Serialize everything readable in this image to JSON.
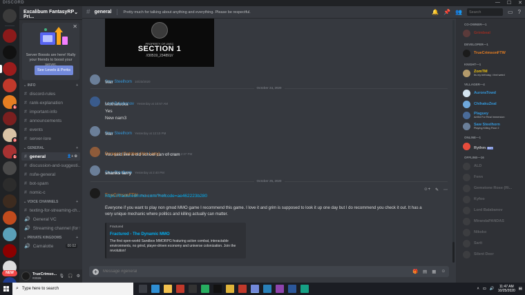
{
  "app": {
    "title": "DISCORD",
    "window_buttons": [
      "—",
      "☐",
      "✕"
    ]
  },
  "guilds": {
    "items": [
      {
        "name": "guild-1",
        "color": "#3b3b3b",
        "badge": ""
      },
      {
        "name": "guild-2",
        "color": "#8b1a1a",
        "badge": ""
      },
      {
        "name": "guild-3",
        "color": "#111111",
        "badge": ""
      },
      {
        "name": "guild-4",
        "color": "#9b1c1c",
        "badge": ""
      },
      {
        "name": "guild-5",
        "color": "#c0392b",
        "badge": ""
      },
      {
        "name": "guild-6",
        "color": "#e67e22",
        "badge": "1"
      },
      {
        "name": "guild-7",
        "color": "#7a1f1f",
        "badge": ""
      },
      {
        "name": "guild-8",
        "color": "#d9c3a5",
        "badge": "3"
      },
      {
        "name": "guild-9",
        "color": "#a83232",
        "badge": "1"
      },
      {
        "name": "guild-10",
        "color": "#4a4a4a",
        "badge": ""
      },
      {
        "name": "guild-11",
        "color": "#2c2c2c",
        "badge": ""
      },
      {
        "name": "guild-12",
        "color": "#3d2b1f",
        "badge": ""
      },
      {
        "name": "guild-13",
        "color": "#c14b1d",
        "badge": ""
      },
      {
        "name": "guild-14",
        "color": "#5aa0b8",
        "badge": ""
      },
      {
        "name": "guild-15",
        "color": "#8b0000",
        "badge": ""
      },
      {
        "name": "guild-16",
        "color": "#dddddd",
        "badge": ""
      },
      {
        "name": "guild-17",
        "color": "#1e3a8a",
        "badge": "1"
      }
    ],
    "new_label": "NEW"
  },
  "server": {
    "name": "Excalibum FantasyRP Pri...",
    "boost": {
      "text": "Server Boosts are here! Rally your friends to boost your server.",
      "button": "See Levels & Perks"
    },
    "categories": [
      {
        "name": "INFO",
        "channels": [
          {
            "label": "discord-rules",
            "type": "text"
          },
          {
            "label": "rank-explanation",
            "type": "text"
          },
          {
            "label": "important-info",
            "type": "text"
          },
          {
            "label": "announcements",
            "type": "text"
          },
          {
            "label": "events",
            "type": "text"
          },
          {
            "label": "server-lore",
            "type": "text"
          }
        ]
      },
      {
        "name": "GENERAL",
        "channels": [
          {
            "label": "general",
            "type": "text",
            "active": true
          },
          {
            "label": "discussion-and-suggesti...",
            "type": "text"
          },
          {
            "label": "nsfw-general",
            "type": "text"
          },
          {
            "label": "bot-spam",
            "type": "text"
          },
          {
            "label": "nomic-c",
            "type": "text"
          }
        ]
      },
      {
        "name": "VOICE CHANNELS",
        "channels": [
          {
            "label": "texting-for-streaming-ch...",
            "type": "text"
          },
          {
            "label": "General VC",
            "type": "voice"
          },
          {
            "label": "Streaming channel (for f...",
            "type": "voice"
          }
        ]
      },
      {
        "name": "PRIVATE KINGDOMS",
        "channels": [
          {
            "label": "Camalotte",
            "type": "voice",
            "count": "00 02"
          }
        ]
      }
    ]
  },
  "user": {
    "name": "TrueCrimso...",
    "tag": "#2026"
  },
  "channel": {
    "name": "general",
    "topic": "Pretty much for talking about anything and everything. Please be respectful.",
    "search_placeholder": "Search"
  },
  "embed_image": {
    "line1": "PROPERTY OF UNSC",
    "line2": "SECTION 1",
    "line3": "//30519_234891//"
  },
  "messages": [
    {
      "author": "Saw Steelhorn",
      "color": "#3498db",
      "time": "10/23/2020",
      "lines": [
        "War"
      ],
      "avatar": "#6b7f99"
    },
    {
      "divider": "October 24, 2020"
    },
    {
      "author": "Lord Balabanov",
      "color": "#3498db",
      "time": "Yesterday at 10:57 AM",
      "lines": [
        "Mothafucka",
        "Yes",
        "New nam3"
      ],
      "avatar": "#3a5b8c"
    },
    {
      "author": "Saw Steelhorn",
      "color": "#3498db",
      "time": "Yesterday at 12:10 PM",
      "lines": [
        "War"
      ],
      "avatar": "#6b7f99"
    },
    {
      "author": "Doragon (Gatcher (Aka Larry)",
      "color": "#e67e22",
      "time": "Yesterday at 2:37 PM",
      "lines": [
        "You said like a old school can of cram"
      ],
      "avatar": "#8e5b3a"
    },
    {
      "author": "Saw Steelhorn",
      "color": "#3498db",
      "time": "Yesterday at 2:40 PM",
      "lines": [
        "shanks larry"
      ],
      "avatar": "#6b7f99"
    },
    {
      "divider": "October 25, 2020"
    },
    {
      "author": "TrueCrimsonFTW",
      "color": "#e67e22",
      "time": "Today at 11:46 AM",
      "avatar": "#1b1b1b",
      "link": "https://fracturedmmo.com/?refcode=ae462223b280",
      "body": "Everyone if you want to play non gmod MMO game I recommend this game.  I love it and grim is supposed to look it up one day but I do recommend you check it out. It has a very unique mechanic where politics and killing actually can matter.",
      "embed": {
        "provider": "Fractured",
        "title": "Fractured - The Dynamic MMO",
        "description": "The first open-world Sandbox MMORPG featuring action combat, interactable environments, no grind, player-driven economy and universe colonization. Join the revolution!"
      }
    }
  ],
  "composer": {
    "placeholder": "Message #general"
  },
  "members": [
    {
      "role": "CO-OWNER—1",
      "items": [
        {
          "name": "Grimbeal",
          "color": "#992d22",
          "status": "",
          "avatar": "#5a3a3a"
        }
      ]
    },
    {
      "role": "DEVELOPER—1",
      "items": [
        {
          "name": "TrueCrimsonFTW",
          "color": "#e67e22",
          "status": "",
          "avatar": "#1b1b1b"
        }
      ]
    },
    {
      "role": "KNIGHT—1",
      "items": [
        {
          "name": "ZomTM",
          "color": "#f1c40f",
          "status": "Its my birthday, i feel weird",
          "avatar": "#b39a6b"
        }
      ]
    },
    {
      "role": "VILLAGER—4",
      "items": [
        {
          "name": "AuroraTowd",
          "color": "#3498db",
          "status": "",
          "avatar": "#d4e4f0"
        },
        {
          "name": "ChihakuZeal",
          "color": "#3498db",
          "status": "",
          "avatar": "#6fa8dc"
        },
        {
          "name": "Plaguey",
          "color": "#3498db",
          "status": "Art/54 For Real Immersion",
          "avatar": "#4a6b99"
        },
        {
          "name": "Saw Steelhorn",
          "color": "#3498db",
          "status": "Playing Killing Floor 2",
          "avatar": "#6b7f99"
        }
      ]
    },
    {
      "role": "ONLINE—1",
      "items": [
        {
          "name": "Rythm",
          "color": "#b9bbbe",
          "status": "",
          "bot": "BOT",
          "avatar": "#e74c3c"
        }
      ]
    },
    {
      "role": "OFFLINE—16",
      "items": [
        {
          "name": "ALD",
          "color": "#b9bbbe",
          "offline": true,
          "avatar": "#555"
        },
        {
          "name": "Fenn",
          "color": "#b9bbbe",
          "offline": true,
          "avatar": "#555"
        },
        {
          "name": "Gemstone Rose (Ri...",
          "color": "#b9bbbe",
          "offline": true,
          "avatar": "#555"
        },
        {
          "name": "Kyfoo",
          "color": "#b9bbbe",
          "offline": true,
          "avatar": "#555"
        },
        {
          "name": "Lord Balabanov",
          "color": "#b9bbbe",
          "offline": true,
          "avatar": "#555"
        },
        {
          "name": "MirandaPANDAS",
          "color": "#b9bbbe",
          "offline": true,
          "avatar": "#555"
        },
        {
          "name": "Nikoko",
          "color": "#b9bbbe",
          "offline": true,
          "avatar": "#555"
        },
        {
          "name": "Sarit",
          "color": "#b9bbbe",
          "offline": true,
          "avatar": "#555"
        },
        {
          "name": "Silent Deer",
          "color": "#b9bbbe",
          "offline": true,
          "avatar": "#555"
        }
      ]
    }
  ],
  "taskbar": {
    "search_placeholder": "Type here to search",
    "apps": [
      {
        "name": "task-view",
        "color": "#3a3d44"
      },
      {
        "name": "edge",
        "color": "#2f8fd4"
      },
      {
        "name": "file-explorer",
        "color": "#f2c14e"
      },
      {
        "name": "app-red",
        "color": "#c0392b"
      },
      {
        "name": "app-dark",
        "color": "#333"
      },
      {
        "name": "app-green",
        "color": "#27ae60"
      },
      {
        "name": "app-black",
        "color": "#111"
      },
      {
        "name": "app-chrome",
        "color": "#e0b43a"
      },
      {
        "name": "app-filezilla",
        "color": "#c0392b"
      },
      {
        "name": "discord",
        "color": "#7289da",
        "running": true
      },
      {
        "name": "app-blue",
        "color": "#2980b9"
      },
      {
        "name": "app-purple",
        "color": "#8e44ad"
      },
      {
        "name": "app-word",
        "color": "#2b579a"
      },
      {
        "name": "app-other",
        "color": "#16a085"
      }
    ],
    "time": "11:47 AM",
    "date": "10/25/2020"
  }
}
